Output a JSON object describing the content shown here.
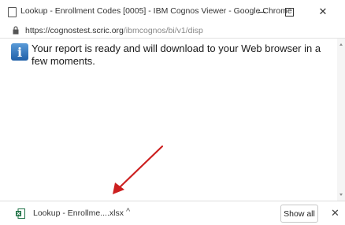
{
  "window": {
    "title": "Lookup - Enrollment Codes [0005] - IBM Cognos Viewer - Google Chrome",
    "minimize_label": "—",
    "maximize_label": "☐",
    "close_label": "✕"
  },
  "address_bar": {
    "host": "https://cognostest.scric.org",
    "path": "/ibmcognos/bi/v1/disp"
  },
  "content": {
    "info_icon_glyph": "i",
    "message": "Your report is ready and will download to your Web browser in a few moments."
  },
  "download_bar": {
    "file_name": "Lookup - Enrollme....xlsx",
    "chevron": "^",
    "show_all_label": "Show all",
    "close_label": "✕"
  },
  "colors": {
    "annotation_arrow": "#cc1f1f",
    "info_icon": "#2f74c0"
  }
}
